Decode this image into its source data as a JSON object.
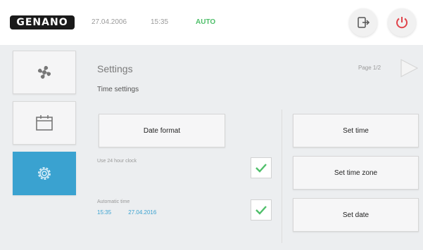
{
  "header": {
    "logo_text": "GENANO",
    "date": "27.04.2006",
    "time": "15:35",
    "mode": "AUTO"
  },
  "sidebar": {
    "items": [
      {
        "icon": "fan-icon"
      },
      {
        "icon": "calendar-icon"
      },
      {
        "icon": "gear-icon",
        "active": true
      }
    ]
  },
  "main": {
    "title": "Settings",
    "subtitle": "Time settings",
    "page_indicator": "Page 1/2",
    "date_format_label": "Date format",
    "use24_label": "Use 24 hour clock",
    "use24_checked": true,
    "automatic_label": "Automatic time",
    "automatic_time": "15:35",
    "automatic_date": "27.04.2016",
    "automatic_checked": true,
    "set_time_label": "Set time",
    "set_timezone_label": "Set time zone",
    "set_date_label": "Set date"
  },
  "colors": {
    "accent": "#3aa2d0",
    "auto_green": "#4fbf6a",
    "power_red": "#e0434a",
    "panel_bg": "#eceef0"
  }
}
